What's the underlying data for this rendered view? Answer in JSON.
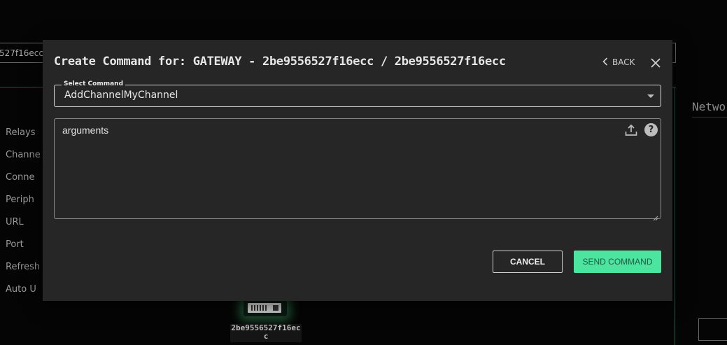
{
  "background": {
    "search_value": "527f16ecc",
    "network_panel": {
      "title": "Netwo",
      "items": [
        "Relays",
        "Channe",
        "Conne",
        "Periph",
        "URL",
        "Port",
        "Refresh",
        "Auto U"
      ]
    },
    "device_label": "2be9556527f16ecc",
    "accent_color": "#4be5a0"
  },
  "dialog": {
    "title": "Create Command for: GATEWAY - 2be9556527f16ecc / 2be9556527f16ecc",
    "back_label": "BACK",
    "back_icon": "chevron-left-icon",
    "close_icon": "close-icon",
    "select": {
      "label": "Select Command",
      "value": "AddChannelMyChannel"
    },
    "arguments": {
      "placeholder": "arguments",
      "upload_icon": "upload-icon",
      "help_icon": "help-icon",
      "help_glyph": "?"
    },
    "cancel_label": "CANCEL",
    "send_label": "SEND COMMAND"
  }
}
